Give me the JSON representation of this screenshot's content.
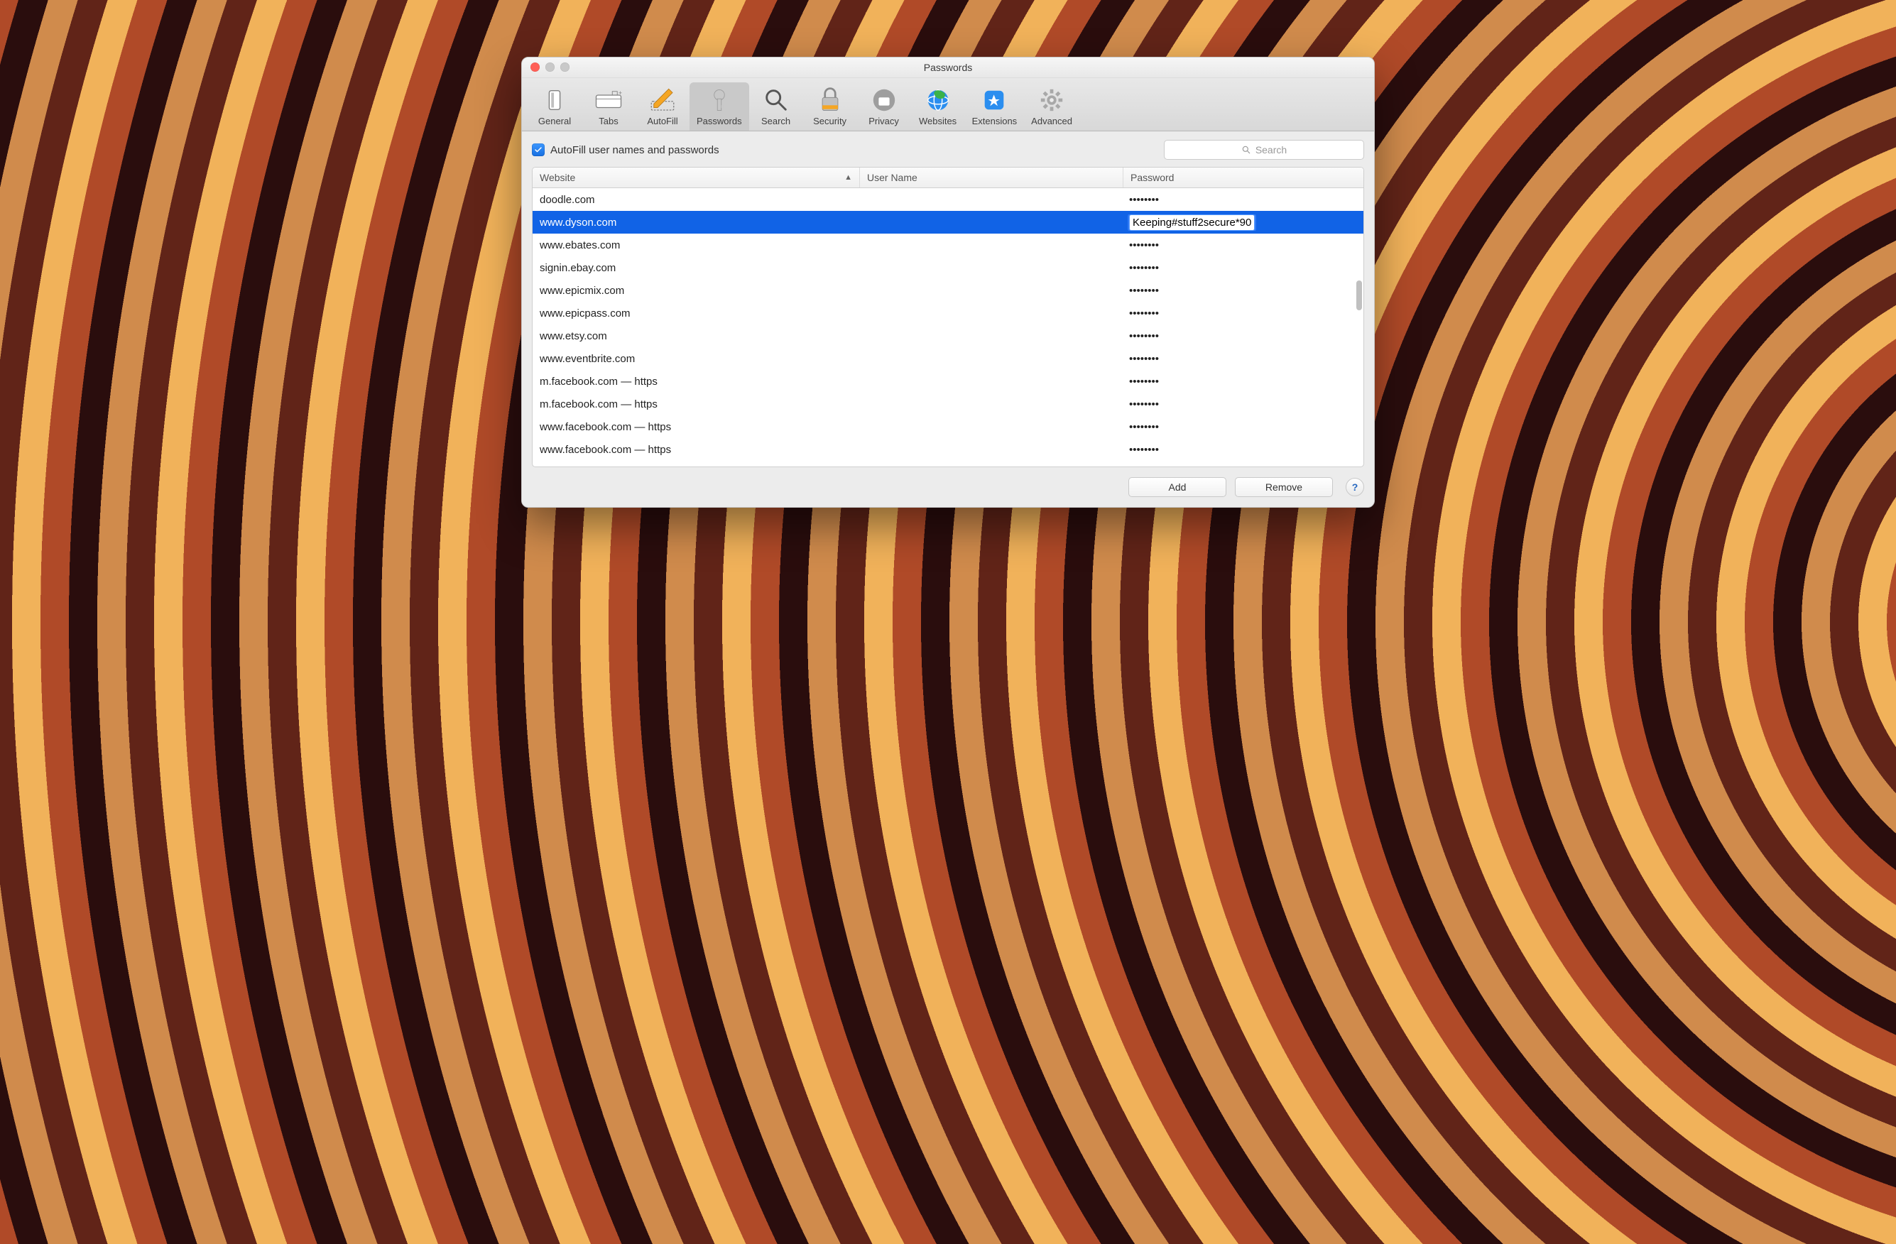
{
  "window_title": "Passwords",
  "toolbar": [
    {
      "id": "general",
      "label": "General",
      "active": false
    },
    {
      "id": "tabs",
      "label": "Tabs",
      "active": false
    },
    {
      "id": "autofill",
      "label": "AutoFill",
      "active": false
    },
    {
      "id": "passwords",
      "label": "Passwords",
      "active": true
    },
    {
      "id": "search",
      "label": "Search",
      "active": false
    },
    {
      "id": "security",
      "label": "Security",
      "active": false
    },
    {
      "id": "privacy",
      "label": "Privacy",
      "active": false
    },
    {
      "id": "websites",
      "label": "Websites",
      "active": false
    },
    {
      "id": "extensions",
      "label": "Extensions",
      "active": false
    },
    {
      "id": "advanced",
      "label": "Advanced",
      "active": false
    }
  ],
  "autofill_checkbox_label": "AutoFill user names and passwords",
  "autofill_checked": true,
  "search_placeholder": "Search",
  "columns": {
    "website": "Website",
    "username": "User Name",
    "password": "Password"
  },
  "rows": [
    {
      "website": "doodle.com",
      "username": "",
      "password": "••••••••",
      "selected": false
    },
    {
      "website": "www.dyson.com",
      "username": "",
      "password": "Keeping#stuff2secure*90",
      "selected": true,
      "editing": true
    },
    {
      "website": "www.ebates.com",
      "username": "",
      "password": "••••••••",
      "selected": false
    },
    {
      "website": "signin.ebay.com",
      "username": "",
      "password": "••••••••",
      "selected": false
    },
    {
      "website": "www.epicmix.com",
      "username": "",
      "password": "••••••••",
      "selected": false
    },
    {
      "website": "www.epicpass.com",
      "username": "",
      "password": "••••••••",
      "selected": false
    },
    {
      "website": "www.etsy.com",
      "username": "",
      "password": "••••••••",
      "selected": false
    },
    {
      "website": "www.eventbrite.com",
      "username": "",
      "password": "••••••••",
      "selected": false
    },
    {
      "website": "m.facebook.com — https",
      "username": "",
      "password": "••••••••",
      "selected": false
    },
    {
      "website": "m.facebook.com — https",
      "username": "",
      "password": "••••••••",
      "selected": false
    },
    {
      "website": "www.facebook.com — https",
      "username": "",
      "password": "••••••••",
      "selected": false
    },
    {
      "website": "www.facebook.com — https",
      "username": "",
      "password": "••••••••",
      "selected": false
    }
  ],
  "buttons": {
    "add": "Add",
    "remove": "Remove",
    "help": "?"
  }
}
